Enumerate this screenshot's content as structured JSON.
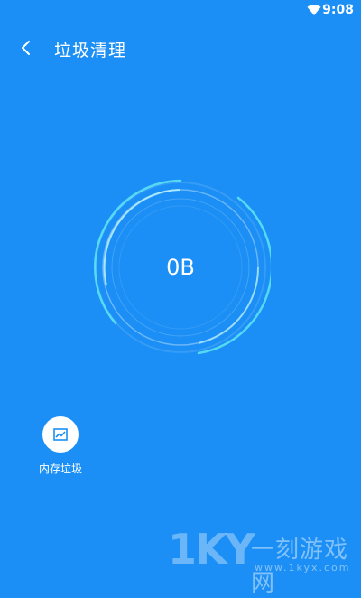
{
  "status_bar": {
    "time": "9:08",
    "wifi_icon": "wifi-icon"
  },
  "header": {
    "back_icon": "chevron-left-icon",
    "title": "垃圾清理"
  },
  "gauge": {
    "value": "0B"
  },
  "actions": {
    "memory_junk": {
      "icon": "chart-icon",
      "label": "内存垃圾"
    }
  },
  "watermark": {
    "logo": "1KY",
    "text": "一刻游戏网",
    "url": "www.1kyx.com"
  },
  "colors": {
    "background": "#1b8ff5",
    "ring_accent": "#5fe6f2",
    "icon_blue": "#1b8ff5"
  }
}
